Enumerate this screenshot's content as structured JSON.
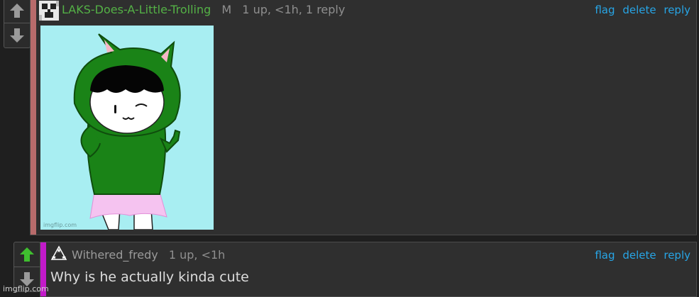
{
  "comments": [
    {
      "username": "LAKS-Does-A-Little-Trolling",
      "badge": "M",
      "stats": "1 up, <1h, 1 reply",
      "actions": {
        "flag": "flag",
        "delete": "delete",
        "reply": "reply"
      },
      "accent_color": "#b86b6b",
      "username_color": "#54b146",
      "image": {
        "watermark": "imgflip.com",
        "background": "#a8eef2",
        "hood_color": "#1a8317",
        "skirt_color": "#f5c3f0"
      }
    },
    {
      "username": "Withered_fredy",
      "stats": "1 up, <1h",
      "text": "Why is he actually kinda cute",
      "actions": {
        "flag": "flag",
        "delete": "delete",
        "reply": "reply"
      },
      "accent_color": "#c21ac9",
      "upvoted": true,
      "upvote_color": "#3fbf2f"
    }
  ],
  "footer_watermark": "imgflip.com",
  "icons": {
    "upvote": "arrow-up-icon",
    "downvote": "arrow-down-icon",
    "avatar1": "pixel-creeper-avatar-icon",
    "avatar2": "triangle-stars-avatar-icon"
  }
}
